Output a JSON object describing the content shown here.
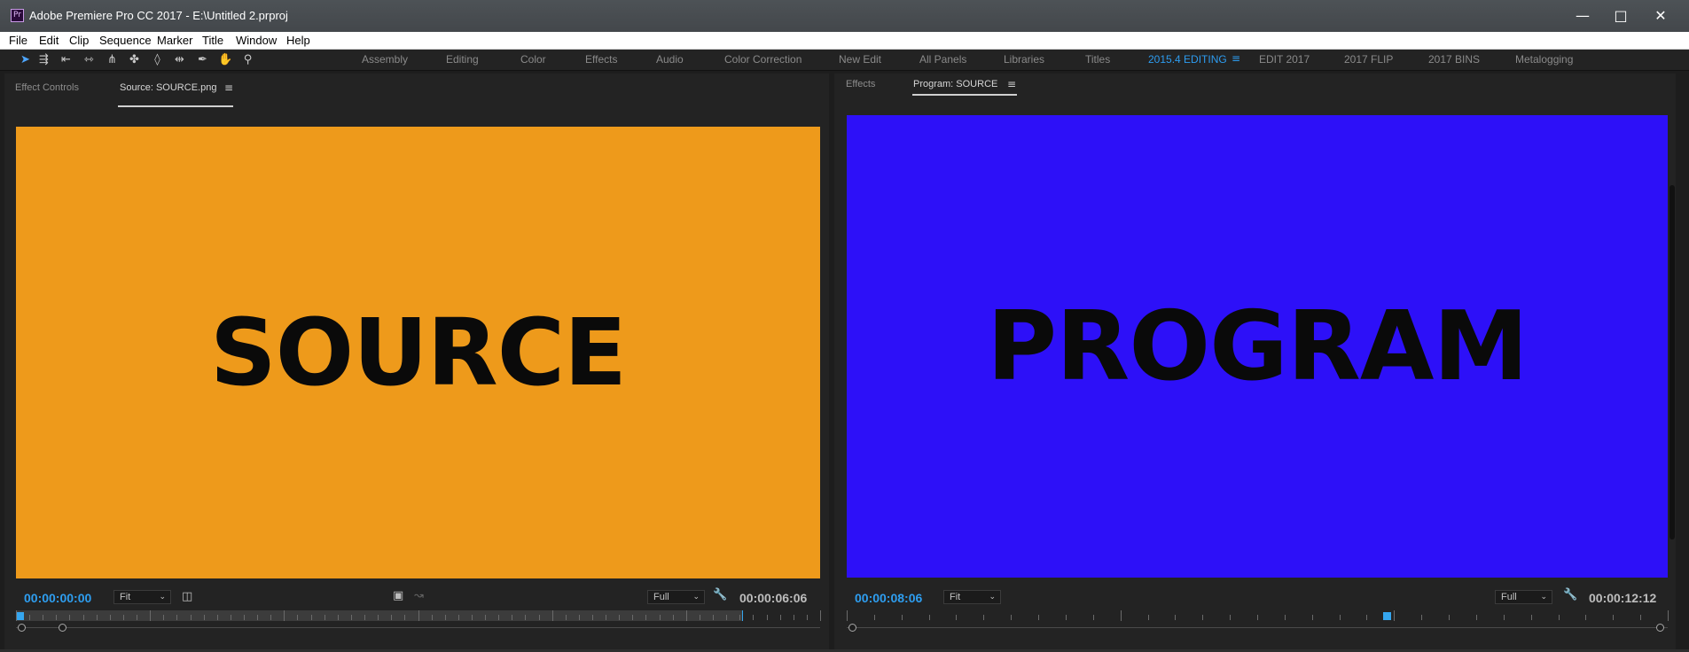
{
  "window": {
    "app_icon": "Pr",
    "title": "Adobe Premiere Pro CC 2017 - E:\\Untitled 2.prproj",
    "minimize_icon": "minimize-icon",
    "maximize_icon": "maximize-icon",
    "close_icon": "close-icon"
  },
  "menu": {
    "items": [
      "File",
      "Edit",
      "Clip",
      "Sequence",
      "Marker",
      "Title",
      "Window",
      "Help"
    ]
  },
  "tools": [
    "selection-tool-icon",
    "track-select-tool-icon",
    "ripple-edit-tool-icon",
    "rolling-edit-tool-icon",
    "rate-stretch-tool-icon",
    "razor-tool-icon",
    "slip-tool-icon",
    "slide-tool-icon",
    "pen-tool-icon",
    "hand-tool-icon",
    "zoom-tool-icon"
  ],
  "workspaces": {
    "items": [
      "Assembly",
      "Editing",
      "Color",
      "Effects",
      "Audio",
      "Color Correction",
      "New Edit",
      "All Panels",
      "Libraries",
      "Titles",
      "2015.4 EDITING",
      "EDIT 2017",
      "2017 FLIP",
      "2017 BINS",
      "Metalogging"
    ],
    "active": "2015.4 EDITING",
    "accent": "#2d9cf0"
  },
  "source_panel": {
    "tabs": [
      "Effect Controls",
      "Source: SOURCE.png"
    ],
    "active_tab": "Source: SOURCE.png",
    "frame_text": "SOURCE",
    "frame_color": "#ee9a1b",
    "timecode_in": "00:00:00:00",
    "fit": "Fit",
    "resolution": "Full",
    "timecode_duration": "00:00:06:06"
  },
  "program_panel": {
    "tabs": [
      "Effects",
      "Program: SOURCE"
    ],
    "active_tab": "Program: SOURCE",
    "frame_text": "PROGRAM",
    "frame_color": "#2d10f8",
    "timecode_in": "00:00:08:06",
    "fit": "Fit",
    "resolution": "Full",
    "timecode_duration": "00:00:12:12"
  }
}
